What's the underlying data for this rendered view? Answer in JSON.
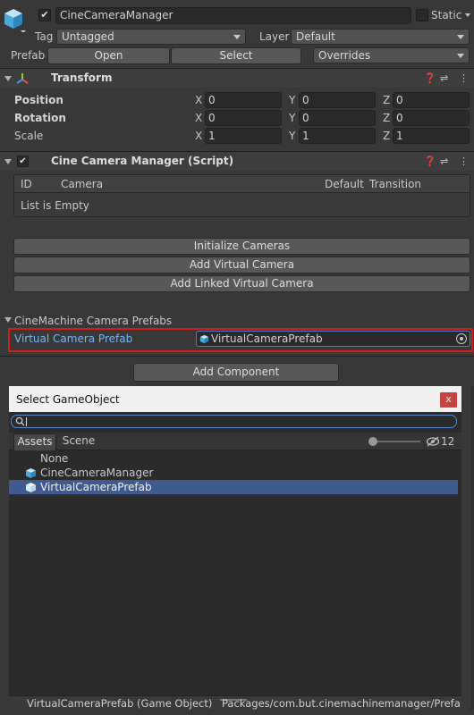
{
  "header": {
    "object_name": "CineCameraManager",
    "static_label": "Static",
    "tag_label": "Tag",
    "tag_value": "Untagged",
    "layer_label": "Layer",
    "layer_value": "Default",
    "prefab_label": "Prefab",
    "open_label": "Open",
    "select_label": "Select",
    "overrides_label": "Overrides"
  },
  "transform": {
    "title": "Transform",
    "rows": [
      {
        "label": "Position",
        "x": "0",
        "y": "0",
        "z": "0"
      },
      {
        "label": "Rotation",
        "x": "0",
        "y": "0",
        "z": "0"
      },
      {
        "label": "Scale",
        "x": "1",
        "y": "1",
        "z": "1"
      }
    ],
    "axis_x": "X",
    "axis_y": "Y",
    "axis_z": "Z"
  },
  "script": {
    "title": "Cine Camera Manager (Script)",
    "columns": [
      "ID",
      "Camera",
      "Default",
      "Transition"
    ],
    "empty_text": "List is Empty",
    "buttons": [
      "Initialize Cameras",
      "Add Virtual Camera",
      "Add Linked Virtual Camera"
    ],
    "prefabs_header": "CineMachine Camera Prefabs",
    "prefab_field_label": "Virtual Camera Prefab",
    "prefab_field_value": "VirtualCameraPrefab",
    "highlight_color": "#d01d1d"
  },
  "add_component_label": "Add Component",
  "picker": {
    "title": "Select GameObject",
    "close_glyph": "x",
    "search_value": "",
    "tabs": [
      "Assets",
      "Scene"
    ],
    "hidden_count": "12",
    "items": [
      {
        "label": "None",
        "selected": false,
        "icon": false
      },
      {
        "label": "CineCameraManager",
        "selected": false,
        "icon": true
      },
      {
        "label": "VirtualCameraPrefab",
        "selected": true,
        "icon": true
      }
    ],
    "status_left": "VirtualCameraPrefab (Game Object)",
    "status_right": "Packages/com.but.cinemachinemanager/Prefa",
    "selection_color": "#3e5a8f"
  }
}
